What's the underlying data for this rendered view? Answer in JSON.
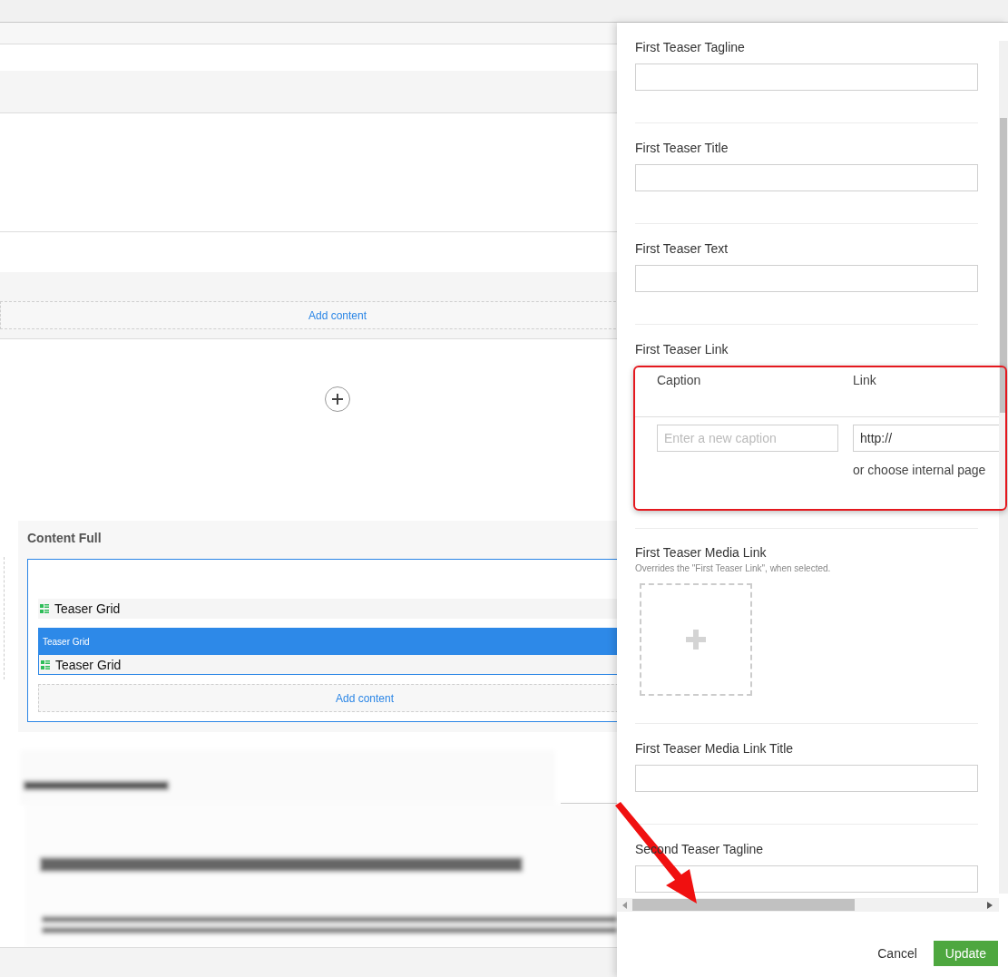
{
  "editor": {
    "add_content": "Add content",
    "content_full": {
      "title": "Content Full",
      "items": [
        {
          "kind": "row",
          "label": "Teaser Grid"
        },
        {
          "kind": "header",
          "label": "Teaser Grid"
        },
        {
          "kind": "row",
          "label": "Teaser Grid"
        }
      ],
      "add_content": "Add content"
    }
  },
  "panel": {
    "fields": [
      {
        "kind": "text",
        "label": "First Teaser Tagline"
      },
      {
        "kind": "text",
        "label": "First Teaser Title"
      },
      {
        "kind": "text",
        "label": "First Teaser Text"
      },
      {
        "kind": "link",
        "label": "First Teaser Link",
        "caption_header": "Caption",
        "link_header": "Link",
        "caption_placeholder": "Enter a new caption",
        "link_value": "http://",
        "internal_page": "or choose internal page"
      },
      {
        "kind": "media",
        "label": "First Teaser Media Link",
        "hint": "Overrides the \"First Teaser Link\", when selected."
      },
      {
        "kind": "text",
        "label": "First Teaser Media Link Title"
      },
      {
        "kind": "text",
        "label": "Second Teaser Tagline"
      }
    ],
    "cancel": "Cancel",
    "update": "Update"
  }
}
